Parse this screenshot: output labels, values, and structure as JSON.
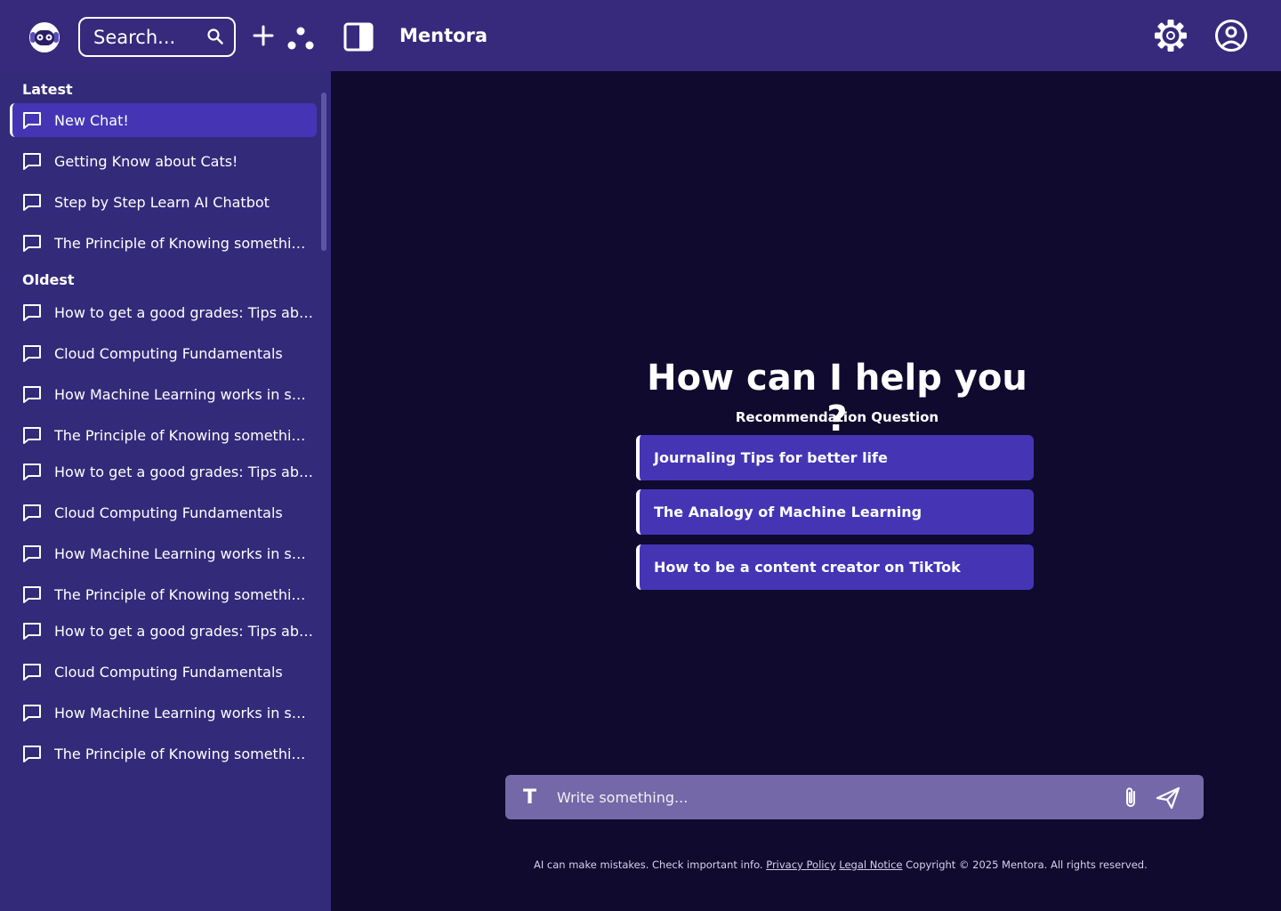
{
  "header": {
    "brand": "Mentora",
    "search_placeholder": "Search..."
  },
  "sidebar": {
    "latest_title": "Latest",
    "oldest_title": "Oldest",
    "latest": [
      {
        "label": "New Chat!"
      },
      {
        "label": "Getting Know about Cats!"
      },
      {
        "label": "Step by Step Learn AI Chatbot"
      },
      {
        "label": "The Principle of Knowing something..."
      }
    ],
    "oldest": [
      {
        "label": "How to get a good grades: Tips abou..."
      },
      {
        "label": "Cloud Computing Fundamentals"
      },
      {
        "label": "How Machine Learning works in sys..."
      },
      {
        "label": "The Principle of Knowing something..."
      },
      {
        "label": "How to get a good grades: Tips abou..."
      },
      {
        "label": "Cloud Computing Fundamentals"
      },
      {
        "label": "How Machine Learning works in sys..."
      },
      {
        "label": "The Principle of Knowing something..."
      },
      {
        "label": "How to get a good grades: Tips abou..."
      },
      {
        "label": "Cloud Computing Fundamentals"
      },
      {
        "label": "How Machine Learning works in sys..."
      },
      {
        "label": "The Principle of Knowing something..."
      }
    ]
  },
  "main": {
    "headline": "How can I help you ?",
    "subheading": "Recommendation Question",
    "recommendations": [
      {
        "label": "Journaling Tips for better life"
      },
      {
        "label": "The Analogy of Machine Learning"
      },
      {
        "label": "How to be a content creator on TikTok"
      }
    ],
    "composer_placeholder": "Write something...",
    "composer_format_glyph": "T"
  },
  "footer": {
    "disclaimer": "AI can make mistakes. Check important info.",
    "privacy": "Privacy Policy",
    "legal": "Legal Notice",
    "copyright": "Copyright © 2025 Mentora. All rights reserved."
  },
  "icons": {
    "logo": "robot-logo-icon",
    "search": "search-icon",
    "new_chat": "plus-icon",
    "explore": "dots-icon",
    "panel": "sidebar-toggle-icon",
    "settings": "gear-icon",
    "account": "user-circle-icon",
    "chat": "chat-bubble-icon",
    "attach": "paperclip-icon",
    "send": "send-icon"
  },
  "colors": {
    "topbar": "#372a7c",
    "sidebar": "#342a7a",
    "main_bg": "#0f0a2e",
    "accent": "#4535b5",
    "composer": "#7568a8"
  }
}
